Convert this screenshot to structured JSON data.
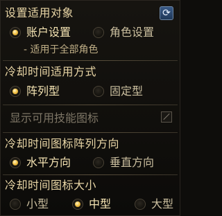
{
  "apply_target": {
    "heading": "设置适用对象",
    "options": [
      {
        "label": "账户设置",
        "selected": true
      },
      {
        "label": "角色设置",
        "selected": false
      }
    ],
    "note": "- 适用于全部角色"
  },
  "cooldown_method": {
    "heading": "冷却时间适用方式",
    "options": [
      {
        "label": "阵列型",
        "selected": true
      },
      {
        "label": "固定型",
        "selected": false
      }
    ]
  },
  "show_usable_icons": {
    "label": "显示可用技能图标",
    "checked": false,
    "enabled": false
  },
  "icon_direction": {
    "heading": "冷却时间图标阵列方向",
    "options": [
      {
        "label": "水平方向",
        "selected": true
      },
      {
        "label": "垂直方向",
        "selected": false
      }
    ]
  },
  "icon_size": {
    "heading": "冷却时间图标大小",
    "options": [
      {
        "label": "小型",
        "selected": false
      },
      {
        "label": "中型",
        "selected": true
      },
      {
        "label": "大型",
        "selected": false
      }
    ]
  },
  "refresh_icon": "refresh-icon",
  "colors": {
    "heading": "#e9d6a6",
    "selected_dot": "#f2c54a",
    "refresh_button": "#2e4d77"
  }
}
